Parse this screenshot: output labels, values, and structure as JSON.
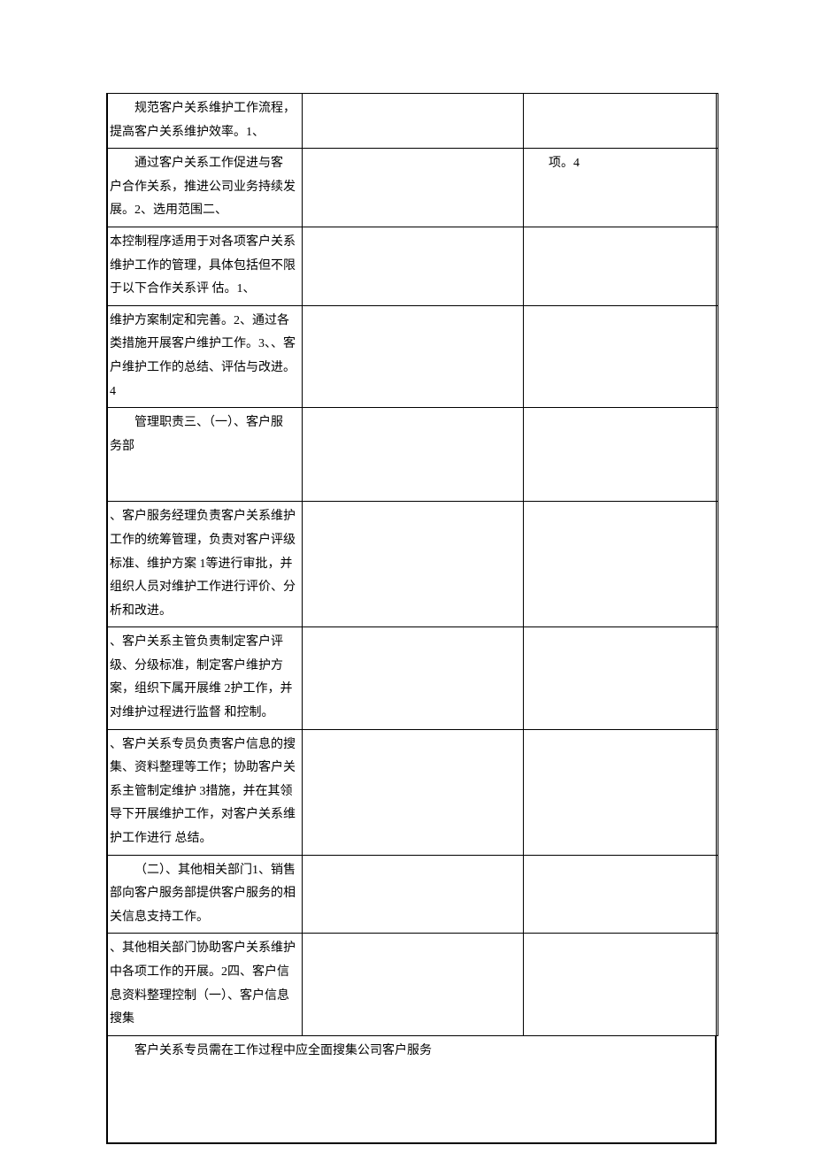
{
  "rows": [
    {
      "left_indent": "规范客户关系维护工作流程，",
      "left_rest": "提高客户关系维护效率。1、",
      "right": ""
    },
    {
      "left_indent": "通过客户关系工作促进与客",
      "left_rest": "户合作关系，推进公司业务持续发展。2、选用范围二、",
      "right": "项。4"
    },
    {
      "left_indent": "",
      "left_rest": "本控制程序适用于对各项客户关系维护工作的管理，具体包括但不限于以下合作关系评 估。1、",
      "right": ""
    },
    {
      "left_indent": "",
      "left_rest": "维护方案制定和完善。2、通过各类措施开展客户维护工作。3、、客户维护工作的总结、评估与改进。4",
      "right": ""
    },
    {
      "left_indent": "管理职责三、（一）、客户服 务部",
      "left_rest": "",
      "right": "",
      "tall": true
    },
    {
      "left_indent": "",
      "left_rest": "、客户服务经理负责客户关系维护工作的统筹管理，负责对客户评级标准、维护方案 1等进行审批，并组织人员对维护工作进行评价、分析和改进。",
      "right": ""
    },
    {
      "left_indent": "",
      "left_rest": "、客户关系主管负责制定客户评级、分级标准，制定客户维护方案，组织下属开展维 2护工作，并对维护过程进行监督 和控制。",
      "right": ""
    },
    {
      "left_indent": "",
      "left_rest": "、客户关系专员负责客户信息的搜集、资料整理等工作；协助客户关系主管制定维护 3措施，并在其领导下开展维护工作，对客户关系维护工作进行 总结。",
      "right": ""
    },
    {
      "left_indent": "（二）、其他相关部门1、销售",
      "left_rest": "部向客户服务部提供客户服务的相关信息支持工作。",
      "right": ""
    },
    {
      "left_indent": "",
      "left_rest": "、其他相关部门协助客户关系维护中各项工作的开展。2四、客户信息资料整理控制（一）、客户信息搜集",
      "right": ""
    }
  ],
  "bottom": "客户关系专员需在工作过程中应全面搜集公司客户服务"
}
